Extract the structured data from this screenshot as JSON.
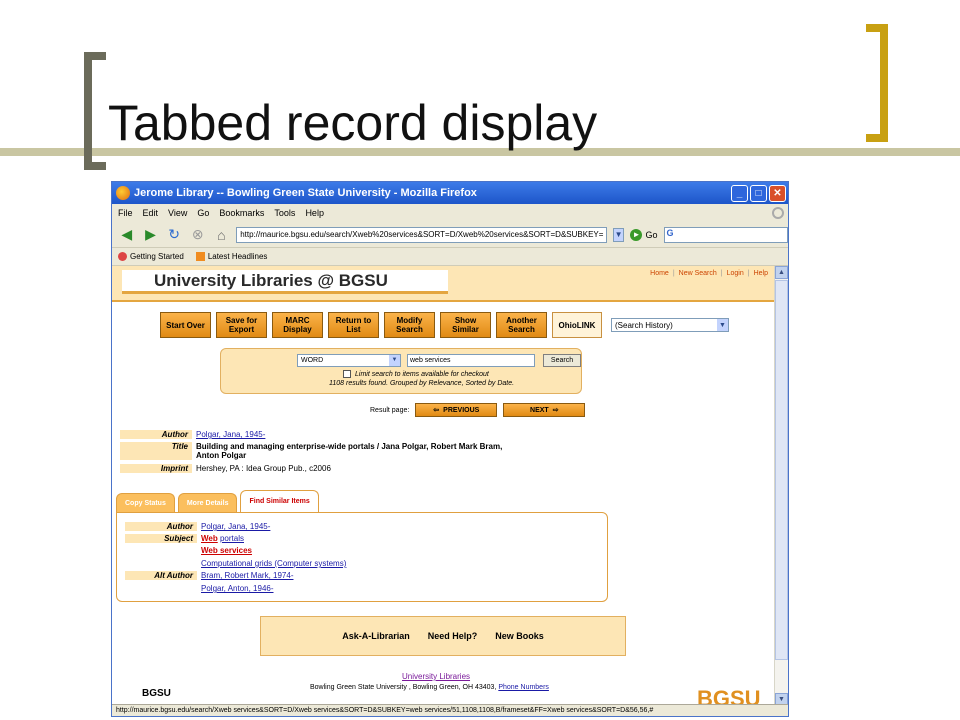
{
  "slide": {
    "title": "Tabbed record display"
  },
  "window": {
    "title": "Jerome Library -- Bowling Green State University - Mozilla Firefox",
    "controls": [
      "_",
      "□",
      "✕"
    ]
  },
  "menu": [
    "File",
    "Edit",
    "View",
    "Go",
    "Bookmarks",
    "Tools",
    "Help"
  ],
  "nav": {
    "url": "http://maurice.bgsu.edu/search/Xweb%20services&SORT=D/Xweb%20services&SORT=D&SUBKEY=",
    "go_label": "Go",
    "search_engine": "G"
  },
  "bookmarks": [
    "Getting Started",
    "Latest Headlines"
  ],
  "page": {
    "banner": "University Libraries @ BGSU",
    "top_links": [
      "Home",
      "New Search",
      "Login",
      "Help"
    ],
    "buttons": [
      "Start Over",
      "Save for Export",
      "MARC Display",
      "Return to List",
      "Modify Search",
      "Show Similar",
      "Another Search",
      "OhioLINK"
    ],
    "history_select": "(Search History)",
    "search": {
      "field": "WORD",
      "query": "web services",
      "submit": "Search",
      "limit_label": "Limit search to items available for checkout",
      "result_info": "1108 results found. Grouped by Relevance, Sorted by Date."
    },
    "pager": {
      "label": "Result page:",
      "prev": "PREVIOUS",
      "next": "NEXT"
    },
    "record": {
      "author_label": "Author",
      "author": "Polgar, Jana, 1945-",
      "title_label": "Title",
      "title_line1": "Building and managing enterprise-wide portals / Jana Polgar, Robert Mark Bram,",
      "title_line2": "Anton Polgar",
      "imprint_label": "Imprint",
      "imprint": "Hershey, PA : Idea Group Pub., c2006"
    },
    "tabs": [
      "Copy Status",
      "More Details",
      "Find Similar Items"
    ],
    "similar": {
      "author_label": "Author",
      "author": "Polgar, Jana, 1945-",
      "subject_label": "Subject",
      "subject1_a": "Web",
      "subject1_b": "portals",
      "subject2": "Web services",
      "subject3": "Computational grids (Computer systems)",
      "alt_label": "Alt Author",
      "alt1": "Bram, Robert Mark, 1974-",
      "alt2": "Polgar, Anton, 1946-"
    },
    "footer_links": [
      "Ask-A-Librarian",
      "Need Help?",
      "New Books"
    ],
    "footer_home": "University Libraries",
    "footer_address": "Bowling Green State University , Bowling Green, OH 43403,",
    "footer_phone": "Phone Numbers",
    "footer_left": "BGSU",
    "footer_logo_a": "BG",
    "footer_logo_b": "SU"
  },
  "status": "http://maurice.bgsu.edu/search/Xweb services&SORT=D/Xweb services&SORT=D&SUBKEY=web services/51,1108,1108,B/frameset&FF=Xweb services&SORT=D&56,56,#"
}
